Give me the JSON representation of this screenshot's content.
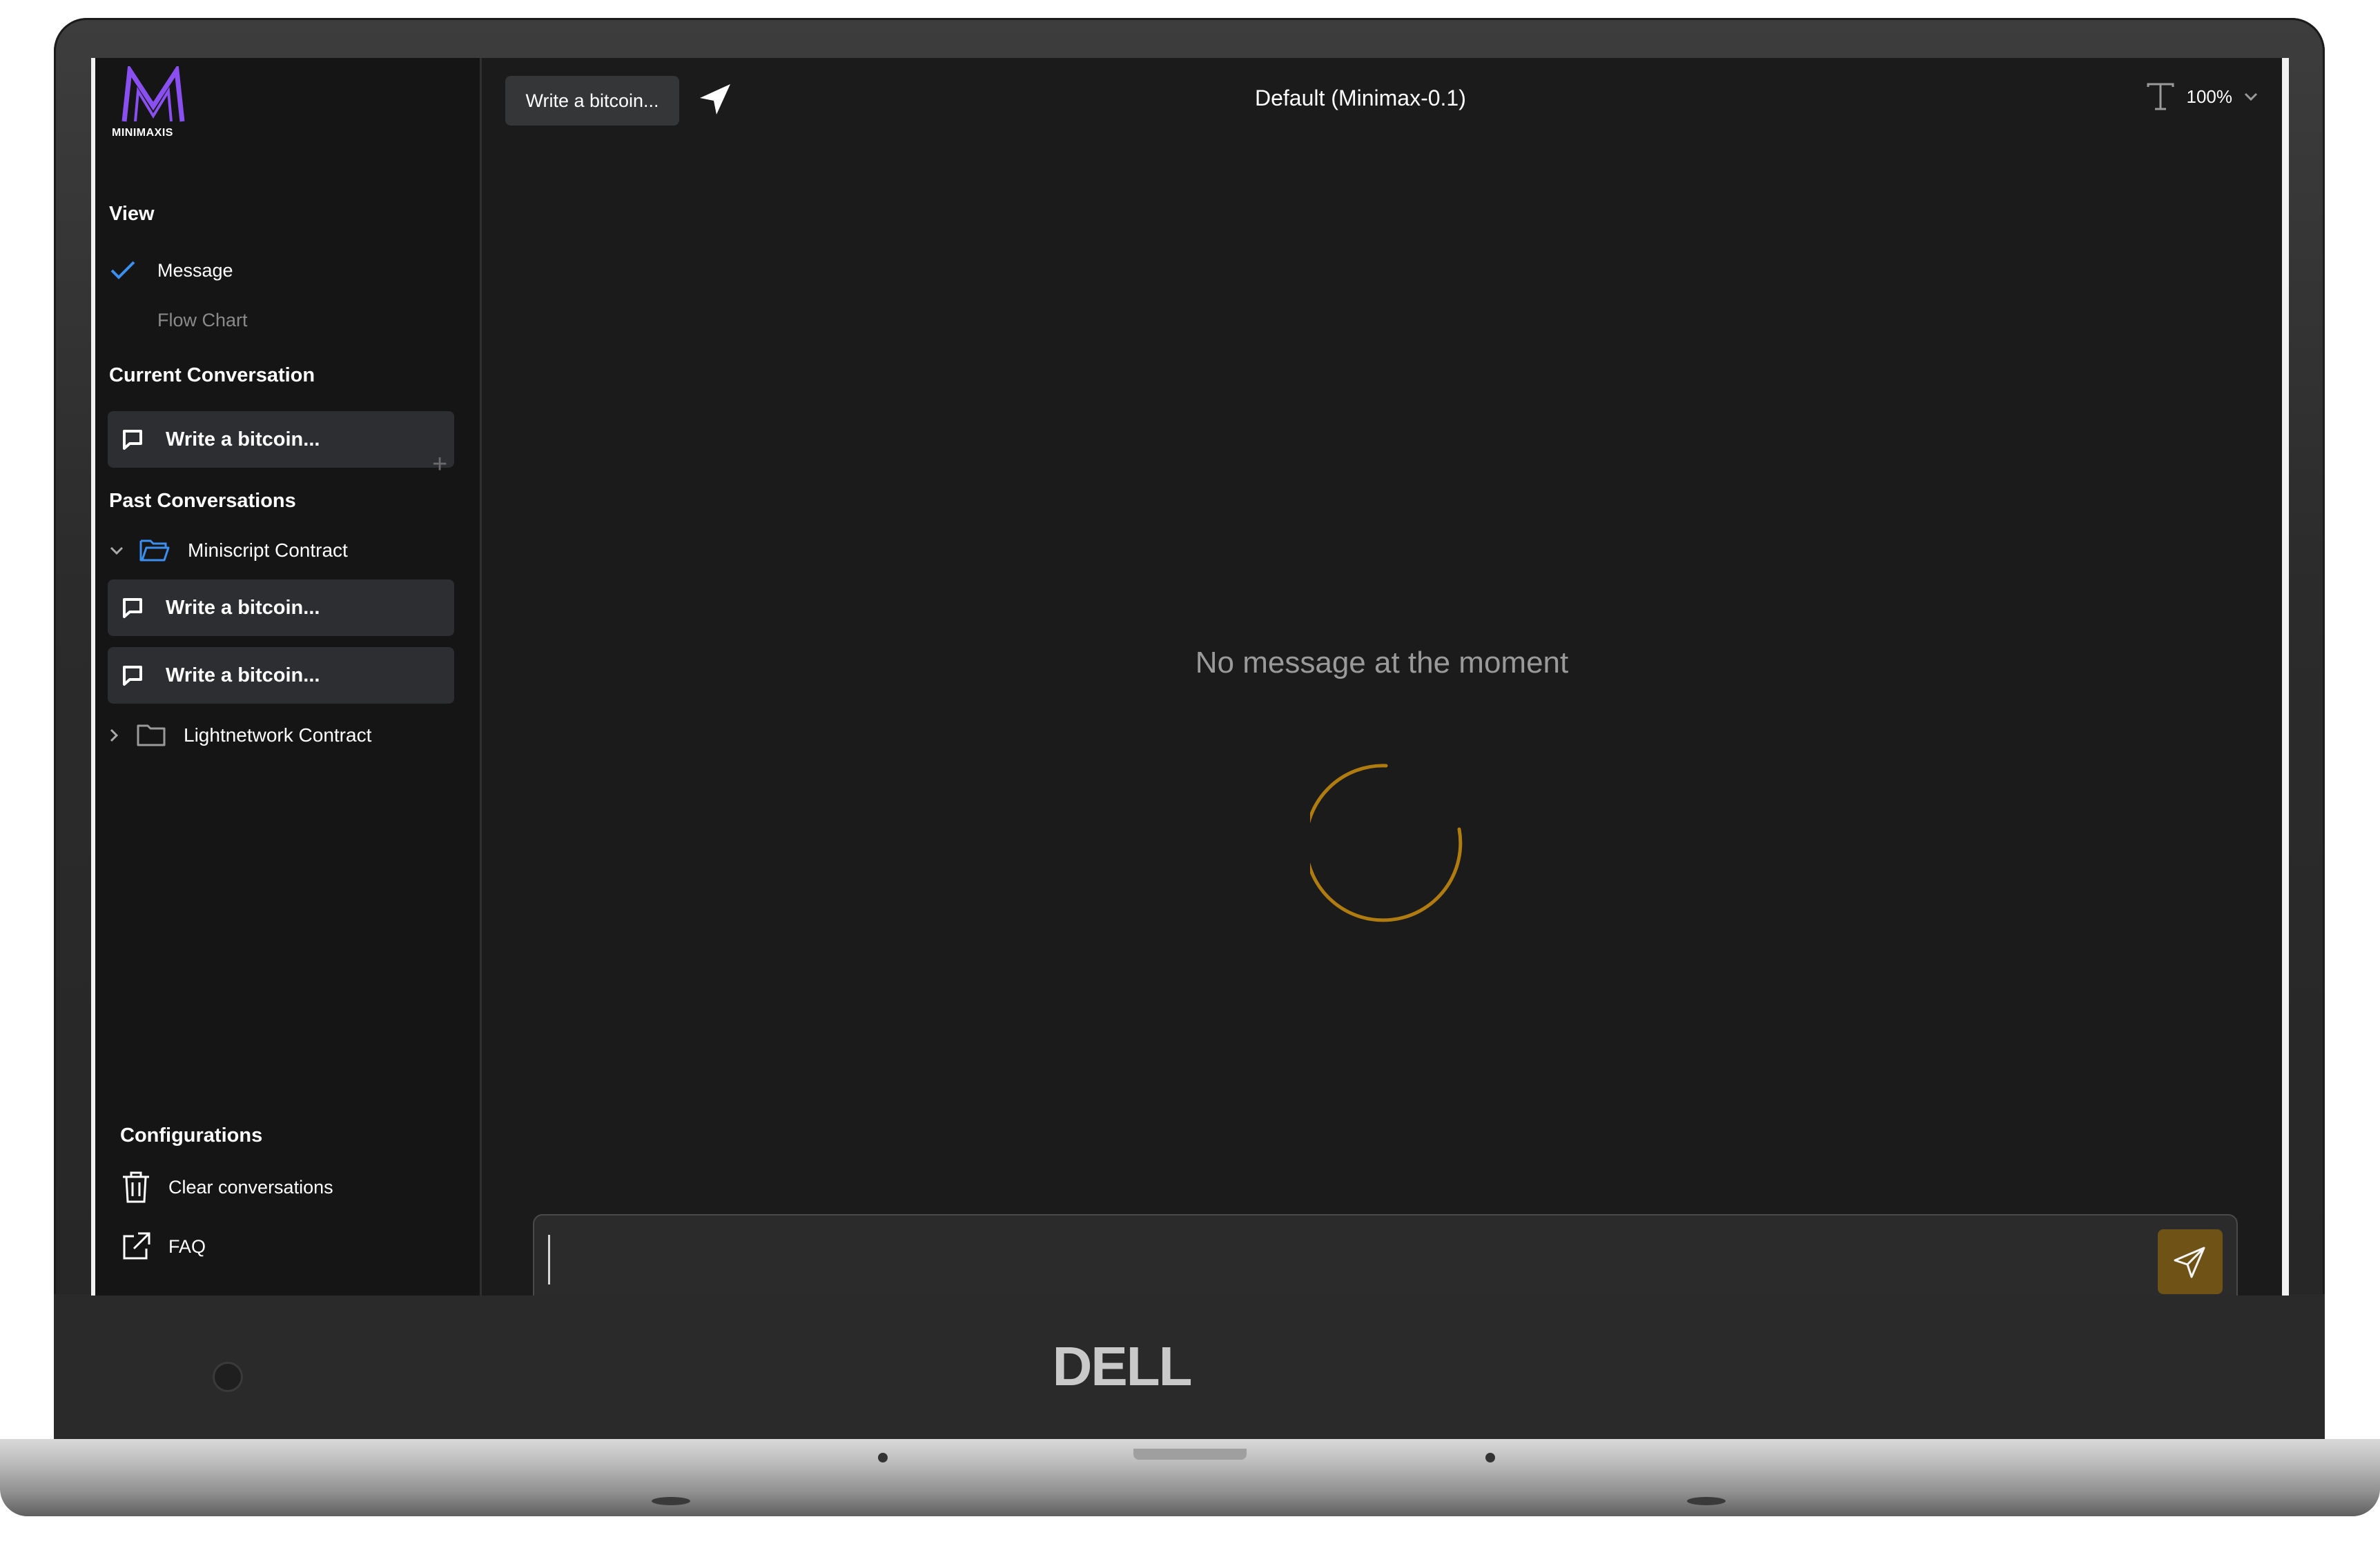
{
  "device": {
    "brand": "DELL"
  },
  "app": {
    "logo_text": "MINIMAXIS",
    "accent_color": "#8a4ff0",
    "spinner_color": "#b07c10"
  },
  "sidebar": {
    "view_title": "View",
    "view_items": [
      {
        "label": "Message",
        "selected": true
      },
      {
        "label": "Flow Chart",
        "selected": false
      }
    ],
    "current_title": "Current Conversation",
    "current_conversation": "Write a bitcoin...",
    "past_title": "Past Conversations",
    "folders": [
      {
        "name": "Miniscript Contract",
        "expanded": true,
        "items": [
          "Write a bitcoin...",
          "Write a bitcoin..."
        ]
      },
      {
        "name": "Lightnetwork Contract",
        "expanded": false,
        "items": []
      }
    ],
    "config_title": "Configurations",
    "config_items": [
      {
        "label": "Clear conversations",
        "icon": "trash-icon"
      },
      {
        "label": "FAQ",
        "icon": "external-link-icon"
      }
    ]
  },
  "main": {
    "chip_label": "Write a bitcoin...",
    "model_title": "Default (Minimax-0.1)",
    "zoom": "100%",
    "empty_message": "No message at the moment",
    "input_value": ""
  }
}
